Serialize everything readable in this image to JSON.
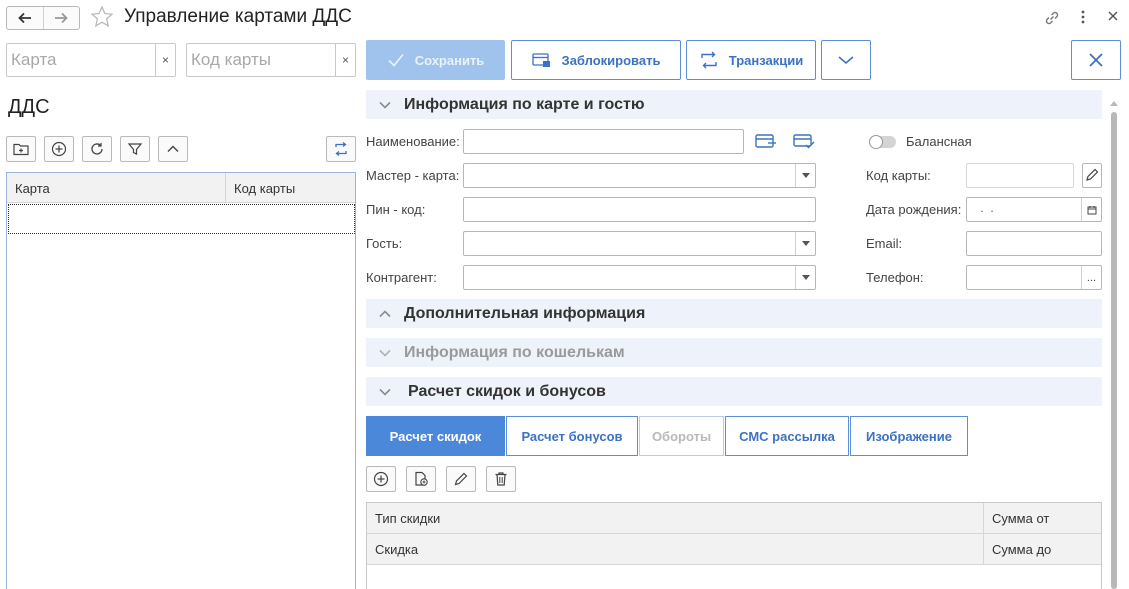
{
  "window": {
    "title": "Управление картами ДДС"
  },
  "left": {
    "filter_card_placeholder": "Карта",
    "filter_code_placeholder": "Код карты",
    "clear_symbol": "×",
    "title": "ДДС",
    "table": {
      "columns": [
        "Карта",
        "Код карты"
      ]
    }
  },
  "toolbar": {
    "save_label": "Сохранить",
    "block_label": "Заблокировать",
    "transactions_label": "Транзакции"
  },
  "sections": {
    "card_info": "Информация по карте и гостю",
    "additional": "Дополнительная информация",
    "wallets": "Информация по кошелькам",
    "discounts": "Расчет скидок и бонусов"
  },
  "form": {
    "name_label": "Наименование:",
    "master_card_label": "Мастер - карта:",
    "pin_label": "Пин - код:",
    "guest_label": "Гость:",
    "contractor_label": "Контрагент:",
    "balance_label": "Балансная",
    "balance_on": false,
    "card_code_label": "Код карты:",
    "birth_date_label": "Дата рождения:",
    "birth_date_value": " .  .",
    "email_label": "Email:",
    "phone_label": "Телефон:",
    "phone_btn": "..."
  },
  "tabs": [
    {
      "label": "Расчет скидок"
    },
    {
      "label": "Расчет бонусов"
    },
    {
      "label": "Обороты"
    },
    {
      "label": "СМС рассылка"
    },
    {
      "label": "Изображение"
    }
  ],
  "grid": {
    "row1": {
      "c1": "Тип скидки",
      "c2": "Сумма от"
    },
    "row2": {
      "c1": "Скидка",
      "c2": "Сумма до"
    }
  },
  "colors": {
    "accent": "#4b88d9",
    "accent_border": "#5d8fd6",
    "section_bg": "#eef2fa",
    "disabled_btn": "#9fc3ec"
  }
}
